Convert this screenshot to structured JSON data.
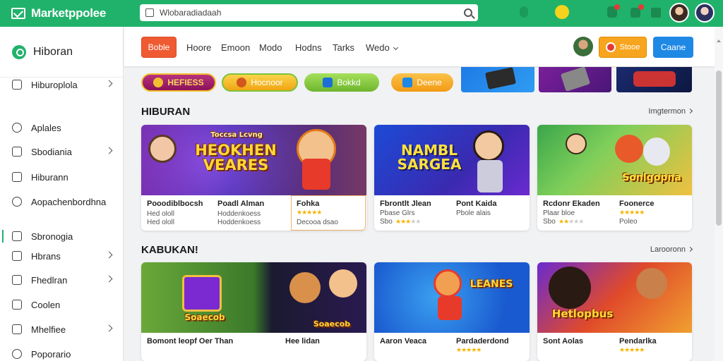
{
  "app": {
    "logo_text": "Marketppolee",
    "search_value": "Wlobaradiadaah",
    "search_placeholder": "Wlobaradiadaah"
  },
  "sidebar": {
    "title": "Hiboran",
    "items": [
      {
        "label": "Hiburoplola",
        "icon": "square-icon",
        "chevron": true
      },
      {
        "label": "Aplales",
        "icon": "refresh-icon",
        "chevron": false
      },
      {
        "label": "Sbodiania",
        "icon": "square-icon",
        "chevron": true
      },
      {
        "label": "Hiburann",
        "icon": "square-icon",
        "chevron": false
      },
      {
        "label": "Aopachenbordhna",
        "icon": "search-icon",
        "chevron": false
      },
      {
        "label": "Sbronogia",
        "icon": "flag-icon",
        "chevron": false
      },
      {
        "label": "Hbrans",
        "icon": "pen-icon",
        "chevron": true
      },
      {
        "label": "Fhedlran",
        "icon": "square-icon",
        "chevron": true
      },
      {
        "label": "Coolen",
        "icon": "lock-icon",
        "chevron": false
      },
      {
        "label": "Mhelfiee",
        "icon": "image-icon",
        "chevron": true
      },
      {
        "label": "Poporario",
        "icon": "refresh-icon",
        "chevron": false
      }
    ]
  },
  "subnav": {
    "primary_button": "Boble",
    "links": [
      "Hoore",
      "Emoon",
      "Modo",
      "Hodns",
      "Tarks",
      "Wedo"
    ],
    "orange_button": "Stooe",
    "blue_button": "Caane"
  },
  "pills": [
    {
      "label": "HEFIESS",
      "color": "#a0216e"
    },
    {
      "label": "Hocnoor",
      "color": "#f5b316"
    },
    {
      "label": "Bokkd",
      "color": "#7cc33a"
    },
    {
      "label": "Deene",
      "color": "#f7a51e"
    }
  ],
  "sections": [
    {
      "title": "HIBURAN",
      "link": "Imgtermon",
      "cards": [
        {
          "image_text": "HEOKHEN VEARES",
          "image_top": "Toccsa Lcvng",
          "columns": [
            {
              "name": "Pooodiblbocsh",
              "sub": "Hed ololl",
              "stars": 0
            },
            {
              "name": "Poadl Alman",
              "sub": "Hoddenkoess",
              "stars": 0
            },
            {
              "name": "Fohka",
              "sub": "Decooa dsao",
              "stars": 5
            }
          ]
        },
        {
          "image_text": "NAMBL SARGEA",
          "columns": [
            {
              "name": "Fbrontlt Jlean",
              "sub": "Pbase Glrs",
              "stars": 3,
              "prefix": "Sbo"
            },
            {
              "name": "Pont Kaida",
              "sub": "Pbole alais",
              "stars": 0
            }
          ]
        },
        {
          "image_text": "Sonlgopna",
          "columns": [
            {
              "name": "Rcdonr Ekaden",
              "sub": "Plaar bloe",
              "stars": 2,
              "prefix": "Sbo"
            },
            {
              "name": "Foonerce",
              "sub": "Poleo",
              "stars": 5
            }
          ]
        }
      ]
    },
    {
      "title": "KABUKAN!",
      "link": "Larooronn",
      "cards": [
        {
          "image_text": "Soaecob",
          "columns": [
            {
              "name": "Bomont leopf Oer Than",
              "sub": "",
              "stars": 0
            },
            {
              "name": "Hee lidan",
              "sub": "",
              "stars": 0
            }
          ]
        },
        {
          "image_text": "LEANES",
          "columns": [
            {
              "name": "Aaron Veaca",
              "sub": "",
              "stars": 0
            },
            {
              "name": "Pardaderdond",
              "sub": "",
              "stars": 5
            }
          ]
        },
        {
          "image_text": "Hetlopbus",
          "columns": [
            {
              "name": "Sont Aolas",
              "sub": "",
              "stars": 0
            },
            {
              "name": "Pendarlka",
              "sub": "",
              "stars": 5
            }
          ]
        }
      ]
    }
  ]
}
